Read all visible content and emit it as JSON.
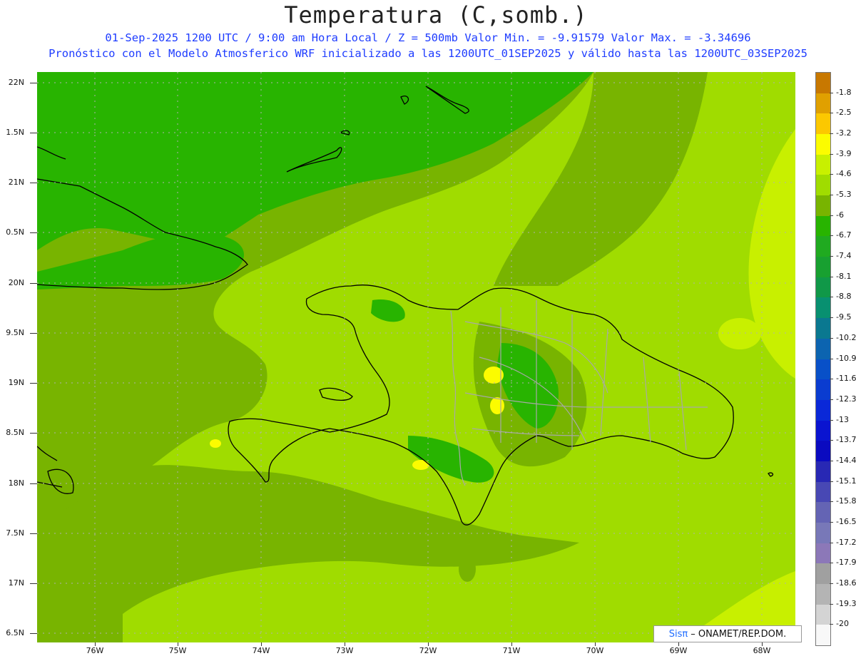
{
  "title": "Temperatura (C,somb.)",
  "subtitle_line1": "01-Sep-2025  1200 UTC / 9:00 am Hora Local / Z = 500mb  Valor Min. = -9.91579  Valor Max. = -3.34696",
  "subtitle_line2": "Pronóstico con el Modelo Atmosferico WRF inicializado a las 1200UTC_01SEP2025 y válido hasta las  1200UTC_03SEP2025",
  "credit": {
    "logo": "Sisπ",
    "text": "– ONAMET/REP.DOM."
  },
  "map": {
    "lat_labels": [
      "22N",
      "1.5N",
      "21N",
      "0.5N",
      "20N",
      "9.5N",
      "19N",
      "8.5N",
      "18N",
      "7.5N",
      "17N",
      "6.5N"
    ],
    "lon_labels": [
      "76W",
      "75W",
      "74W",
      "73W",
      "72W",
      "71W",
      "70W",
      "69W",
      "68W"
    ],
    "lat_range": [
      16.4,
      22.1
    ],
    "lon_range": [
      -76.65,
      -67.55
    ]
  },
  "legend": {
    "labels": [
      "-1.8",
      "-2.5",
      "-3.2",
      "-3.9",
      "-4.6",
      "-5.3",
      "-6",
      "-6.7",
      "-7.4",
      "-8.1",
      "-8.8",
      "-9.5",
      "-10.2",
      "-10.9",
      "-11.6",
      "-12.3",
      "-13",
      "-13.7",
      "-14.4",
      "-15.1",
      "-15.8",
      "-16.5",
      "-17.2",
      "-17.9",
      "-18.6",
      "-19.3",
      "-20"
    ],
    "colors": [
      "#c87800",
      "#e0a000",
      "#fcc800",
      "#fcfc00",
      "#c8f000",
      "#a0dc00",
      "#78b400",
      "#28b400",
      "#20aa20",
      "#18a030",
      "#109848",
      "#089070",
      "#0a7890",
      "#0c64b0",
      "#0850c8",
      "#0a3cd0",
      "#0a28d8",
      "#0a14d0",
      "#0a0ac0",
      "#2828b4",
      "#4848b4",
      "#6464b4",
      "#7878b8",
      "#8c78b8",
      "#a0a0a0",
      "#b4b4b4",
      "#d4d4d4",
      "#f8f8f8"
    ]
  },
  "colors": {
    "field_dark": "#28b400",
    "field_mid": "#78b400",
    "field_light": "#a0dc00",
    "field_lighter": "#c8f000",
    "field_yellow": "#fcfc00",
    "coast": "#000000",
    "borders": "#a8a8a8",
    "text_blue": "#1e3cff"
  }
}
